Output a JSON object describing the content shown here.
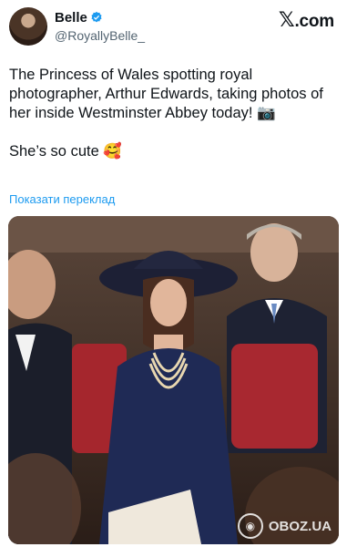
{
  "author": {
    "display_name": "Belle",
    "handle": "@RoyallyBelle_",
    "verified": true
  },
  "brand": {
    "logo_text": ".com",
    "logo_glyph": "𝕏"
  },
  "tweet": {
    "text_1": "The Princess of Wales spotting royal photographer, Arthur Edwards, taking photos of her inside Westminster Abbey today! 📷",
    "text_2": "She’s so cute 🥰"
  },
  "translate_link": "Показати переклад",
  "media": {
    "watermark": "OBOZ.UA"
  },
  "colors": {
    "link": "#1d9bf0",
    "verified": "#1d9bf0",
    "secondary_text": "#536471"
  }
}
